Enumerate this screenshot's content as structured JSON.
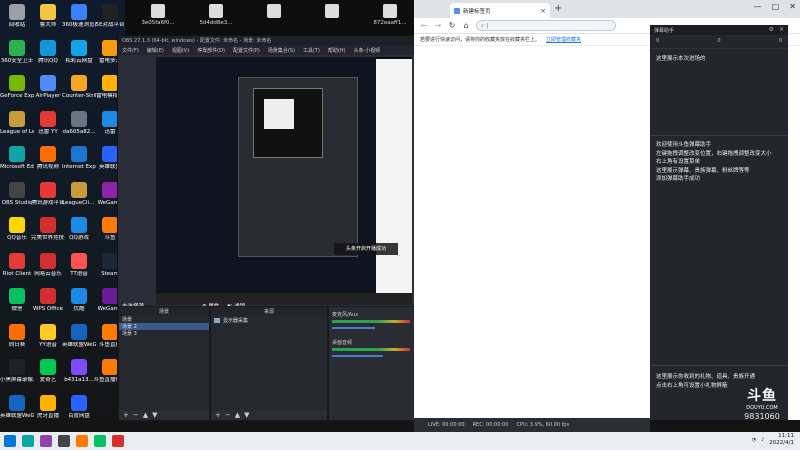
{
  "desktop": {
    "icons": [
      {
        "label": "回收站",
        "color": "#9aa0a6"
      },
      {
        "label": "鲁大师",
        "color": "#f5c542"
      },
      {
        "label": "360极速浏览器",
        "color": "#3b82f6"
      },
      {
        "label": "5E对战平台",
        "color": "#222222"
      },
      {
        "label": "360安全卫士",
        "color": "#2bb24c"
      },
      {
        "label": "腾讯QQ",
        "color": "#1296db"
      },
      {
        "label": "和彩云网盘",
        "color": "#0ea5e9"
      },
      {
        "label": "雷电多开",
        "color": "#f59e0b"
      },
      {
        "label": "GeForce Experience",
        "color": "#76b900"
      },
      {
        "label": "AirPlayer",
        "color": "#4f8cf5"
      },
      {
        "label": "Counter-Strike Global Off...",
        "color": "#f5a623"
      },
      {
        "label": "雷电模拟器",
        "color": "#ffb300"
      },
      {
        "label": "League of Legends",
        "color": "#c89b3c"
      },
      {
        "label": "迅雷 YY",
        "color": "#e53935"
      },
      {
        "label": "da605a82...",
        "color": "#6b7280"
      },
      {
        "label": "迅雷",
        "color": "#1e88e5"
      },
      {
        "label": "Microsoft Edge",
        "color": "#0ea5a5"
      },
      {
        "label": "腾讯视频",
        "color": "#ff6d00"
      },
      {
        "label": "Internet Explorer",
        "color": "#1976d2"
      },
      {
        "label": "英雄联盟",
        "color": "#2962ff"
      },
      {
        "label": "OBS Studio",
        "color": "#444444"
      },
      {
        "label": "腾讯游戏平台",
        "color": "#e53935"
      },
      {
        "label": "LeagueCli... 快捷方式",
        "color": "#c89b3c"
      },
      {
        "label": "WeGame",
        "color": "#8e24aa"
      },
      {
        "label": "QQ音乐",
        "color": "#ffd600"
      },
      {
        "label": "完美世界竞技平台",
        "color": "#d32f2f"
      },
      {
        "label": "QQ游戏",
        "color": "#1e88e5"
      },
      {
        "label": "斗鱼",
        "color": "#ff7a00"
      },
      {
        "label": "Riot Client",
        "color": "#e53935"
      },
      {
        "label": "网易云音乐",
        "color": "#d32f2f"
      },
      {
        "label": "TT语音",
        "color": "#ff5252"
      },
      {
        "label": "Steam",
        "color": "#1b2838"
      },
      {
        "label": "微信",
        "color": "#07c160"
      },
      {
        "label": "WPS Office",
        "color": "#d32f2f"
      },
      {
        "label": "优酷",
        "color": "#1e88e5"
      },
      {
        "label": "WeGame",
        "color": "#6a1b9a"
      },
      {
        "label": "向日葵",
        "color": "#ff6f00"
      },
      {
        "label": "YY语音",
        "color": "#ffca28"
      },
      {
        "label": "英雄联盟WeGame版",
        "color": "#1565c0"
      },
      {
        "label": "斗鱼直播",
        "color": "#ff7a00"
      },
      {
        "label": "小黑屏幕录像工具",
        "color": "#222222"
      },
      {
        "label": "爱奇艺",
        "color": "#00c853"
      },
      {
        "label": "b431a13...",
        "color": "#7c4dff"
      },
      {
        "label": "斗鱼直播伴侣",
        "color": "#ff7a00"
      },
      {
        "label": "英雄联盟WeGame版",
        "color": "#1565c0"
      },
      {
        "label": "虎牙直播",
        "color": "#ffb300"
      },
      {
        "label": "百度网盘",
        "color": "#2962ff"
      }
    ]
  },
  "top_thumbs": [
    {
      "label": "3e05fa6f0...",
      "color": "#dddddd"
    },
    {
      "label": "5d4dd8e3...",
      "color": "#dddddd"
    },
    {
      "label": "",
      "color": "#dddddd"
    },
    {
      "label": "",
      "color": "#dddddd"
    },
    {
      "label": "872eaaff1...",
      "color": "#dddddd"
    }
  ],
  "obs": {
    "title": "OBS 27.1.3 (64-bit, windows) - 配置文件: 未命名 - 场景: 未命名",
    "menu": [
      "文件(F)",
      "编辑(E)",
      "视图(V)",
      "停靠部件(D)",
      "配置文件(P)",
      "场景集合(S)",
      "工具(T)",
      "帮助(H)",
      "头条·小视频"
    ],
    "inner_toast": "头条开启开播成功",
    "no_source": "未选择源",
    "property_btn": "属性",
    "filter_btn": "滤镜",
    "scenes": {
      "title": "场景",
      "items": [
        "场景",
        "场景 2",
        "场景 3"
      ],
      "selected_index": 1
    },
    "sources": {
      "title": "来源",
      "items": [
        "显示器采集"
      ]
    },
    "mixer": {
      "rows": [
        {
          "label": "麦克风/Aux",
          "level": 0.55
        },
        {
          "label": "桌面音频",
          "level": 0.65
        }
      ]
    },
    "footer_icons": [
      "+",
      "−",
      "▲",
      "▼"
    ]
  },
  "browser": {
    "tab_title": "新建标签页",
    "omnibox_placeholder": "",
    "bookmark_text": "若要进行快速访问，请将你的收藏夹放在收藏夹栏上。",
    "bookmark_link": "立即管理收藏夹",
    "controls": {
      "min": "—",
      "max": "□",
      "close": "✕"
    }
  },
  "danmu": {
    "header": "弹幕助手",
    "stats": [
      "0",
      "0",
      "0"
    ],
    "welcome": "这里展示本次进场的",
    "help_lines": [
      "欢迎使用斗鱼弹幕助手",
      "左键拖拽调整改变位置，右键拖拽调整改变大小",
      "右上角有设置菜单",
      "这里展示弹幕、贵族弹幕、粉丝牌等等",
      "添加弹幕助手成功"
    ],
    "gift_lines": [
      "这里展示你收到的礼物、道具、贵族开通",
      "点击右上角可设置小礼物屏蔽"
    ]
  },
  "statusbar": {
    "items": [
      "LIVE: 00:00:00",
      "REC: 00:00:00",
      "CPU: 3.9%, 60.00 fps"
    ]
  },
  "watermark": {
    "logo": "斗鱼",
    "brand": "DOUYU.COM",
    "room": "9831060"
  },
  "taskbar": {
    "time": "11:11",
    "date": "2022/4/1",
    "apps": [
      {
        "name": "windows-start-icon",
        "color": "#0078d7"
      },
      {
        "name": "edge-icon",
        "color": "#0ea5a5"
      },
      {
        "name": "chrome-like-icon",
        "color": "#8e44ad"
      },
      {
        "name": "obs-icon",
        "color": "#444444"
      },
      {
        "name": "douyu-icon",
        "color": "#ff7a00"
      },
      {
        "name": "wechat-icon",
        "color": "#07c160"
      },
      {
        "name": "netease-icon",
        "color": "#d32f2f"
      }
    ]
  }
}
